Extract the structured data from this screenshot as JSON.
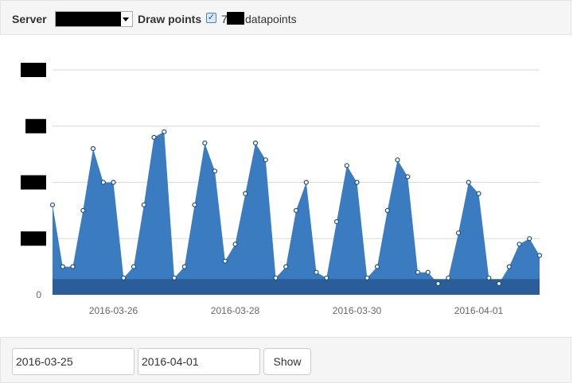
{
  "toolbar": {
    "server_label": "Server",
    "draw_points_label": "Draw points",
    "draw_points_checked": true,
    "datapoints_prefix": "7",
    "datapoints_suffix": "datapoints"
  },
  "chart_data": {
    "type": "area",
    "title": "",
    "xlabel": "",
    "ylabel": "",
    "x_tick_labels": [
      "2016-03-26",
      "2016-03-28",
      "2016-03-30",
      "2016-04-01"
    ],
    "y_tick_labels": [
      "0"
    ],
    "y_labels_redacted": true,
    "grid": "horizontal",
    "points_drawn": true,
    "series": [
      {
        "color": "#3a7cbf",
        "x": [
          0,
          4,
          8,
          12,
          16,
          20,
          24,
          28,
          32,
          36,
          40,
          44,
          48,
          52,
          56,
          60,
          64,
          68,
          72,
          76,
          80,
          84,
          88,
          92,
          96,
          100,
          104,
          108,
          112,
          116,
          120,
          124,
          128,
          132,
          136,
          140,
          144,
          148,
          152,
          156,
          160,
          164,
          168,
          172,
          176,
          180,
          184,
          188,
          192
        ],
        "values": [
          1.6,
          0.5,
          0.5,
          1.5,
          2.6,
          2.0,
          2.0,
          0.3,
          0.5,
          1.6,
          2.8,
          2.9,
          0.3,
          0.5,
          1.6,
          2.7,
          2.2,
          0.6,
          0.9,
          1.8,
          2.7,
          2.4,
          0.3,
          0.5,
          1.5,
          2.0,
          0.4,
          0.3,
          1.3,
          2.3,
          2.0,
          0.3,
          0.5,
          1.5,
          2.4,
          2.1,
          0.4,
          0.4,
          0.2,
          0.3,
          1.1,
          2.0,
          1.8,
          0.3,
          0.2,
          0.5,
          0.9,
          1.0,
          0.7
        ]
      },
      {
        "color": "#2b5d99",
        "x": [
          0,
          192
        ],
        "values": [
          0.28,
          0.28
        ]
      }
    ]
  },
  "controls": {
    "from_date": "2016-03-25",
    "to_date": "2016-04-01",
    "show_label": "Show"
  }
}
